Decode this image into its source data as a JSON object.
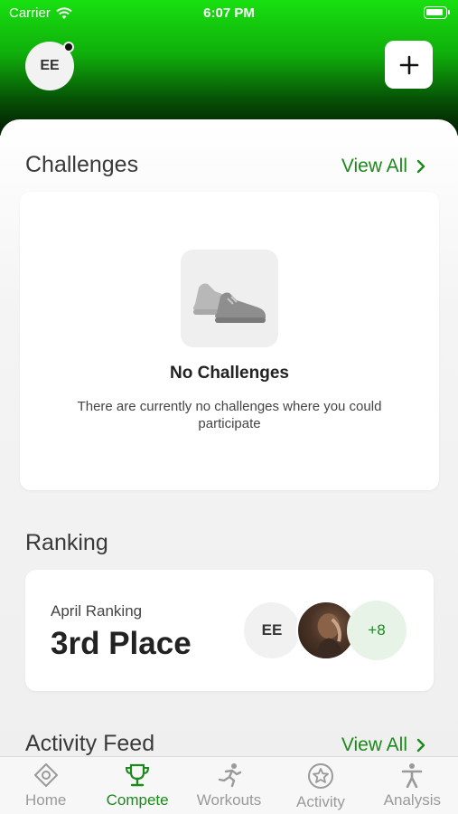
{
  "status": {
    "carrier": "Carrier",
    "time": "6:07 PM"
  },
  "header": {
    "avatar_initials": "EE"
  },
  "challenges": {
    "title": "Challenges",
    "view_all": "View All",
    "empty_title": "No Challenges",
    "empty_desc": "There are currently no challenges where you could participate"
  },
  "ranking": {
    "title": "Ranking",
    "label": "April Ranking",
    "value": "3rd Place",
    "avatar_initials": "EE",
    "more_count": "+8"
  },
  "activity": {
    "title": "Activity Feed",
    "view_all": "View All"
  },
  "tabs": [
    {
      "label": "Home",
      "icon": "diamond-icon"
    },
    {
      "label": "Compete",
      "icon": "trophy-icon"
    },
    {
      "label": "Workouts",
      "icon": "runner-icon"
    },
    {
      "label": "Activity",
      "icon": "star-badge-icon"
    },
    {
      "label": "Analysis",
      "icon": "person-icon"
    }
  ],
  "colors": {
    "accent": "#1b8a1b",
    "header_green": "#18e010"
  }
}
